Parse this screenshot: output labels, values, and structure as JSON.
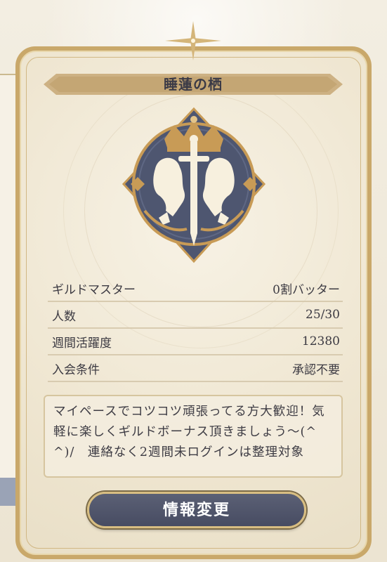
{
  "guild": {
    "name": "睡蓮の栖"
  },
  "info": [
    {
      "label": "ギルドマスター",
      "value": "0割バッター"
    },
    {
      "label": "人数",
      "value": "25/30"
    },
    {
      "label": "週間活躍度",
      "value": "12380"
    },
    {
      "label": "入会条件",
      "value": "承認不要"
    }
  ],
  "description": "マイペースでコツコツ頑張ってる方大歓迎！気軽に楽しくギルドボーナス頂きましょう〜(^^)/　連絡なく2週間未ログインは整理対象",
  "actions": {
    "edit_label": "情報変更"
  },
  "emblem": {
    "icon": "lion-sword-crest-icon",
    "colors": {
      "background": "#4e5670",
      "gold": "#c89b56",
      "ivory": "#f7f0de"
    }
  }
}
